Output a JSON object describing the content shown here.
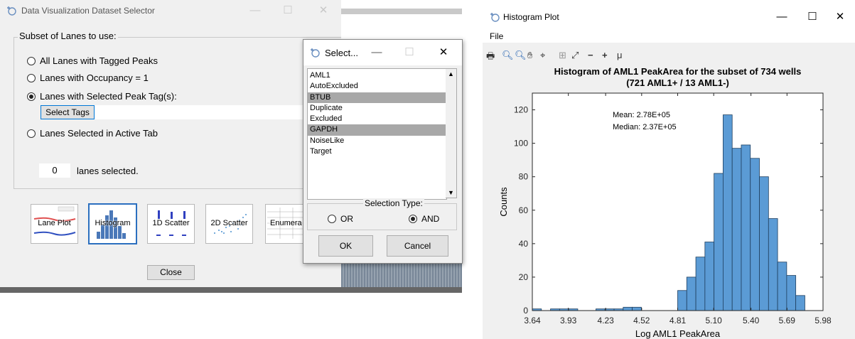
{
  "selector_window": {
    "title": "Data Visualization Dataset Selector",
    "group_title": "Subset of Lanes to use:",
    "options": [
      {
        "label": "All Lanes with Tagged Peaks",
        "selected": false
      },
      {
        "label": "Lanes with Occupancy = 1",
        "selected": false
      },
      {
        "label": "Lanes with Selected Peak Tag(s):",
        "selected": true
      },
      {
        "label": "Lanes Selected in Active Tab",
        "selected": false
      }
    ],
    "select_tags_button": "Select Tags",
    "lanes_count": "0",
    "lanes_selected_label": "lanes selected.",
    "thumbnails": [
      {
        "label": "Lane Plot",
        "selected": false
      },
      {
        "label": "Histogram",
        "selected": true
      },
      {
        "label": "1D Scatter",
        "selected": false
      },
      {
        "label": "2D Scatter",
        "selected": false
      },
      {
        "label": "Enumera",
        "selected": false
      }
    ],
    "close_button": "Close"
  },
  "select_dialog": {
    "title": "Select...",
    "items": [
      {
        "label": "AML1",
        "selected": false
      },
      {
        "label": "AutoExcluded",
        "selected": false
      },
      {
        "label": "BTUB",
        "selected": true
      },
      {
        "label": "Duplicate",
        "selected": false
      },
      {
        "label": "Excluded",
        "selected": false
      },
      {
        "label": "GAPDH",
        "selected": true
      },
      {
        "label": "NoiseLike",
        "selected": false
      },
      {
        "label": "Target",
        "selected": false
      }
    ],
    "selection_type_label": "Selection Type:",
    "or_label": "OR",
    "and_label": "AND",
    "selection_type": "AND",
    "ok_button": "OK",
    "cancel_button": "Cancel"
  },
  "histogram_window": {
    "title": "Histogram Plot",
    "menu_file": "File",
    "toolbar_icons": [
      "print-icon",
      "zoom-in-icon",
      "zoom-out-icon",
      "pan-icon",
      "data-cursor-icon",
      "grid-icon",
      "fit-icon",
      "minus-icon",
      "plus-icon",
      "mu-icon"
    ],
    "toolbar_text": {
      "minus": "−",
      "plus": "+",
      "mu": "μ"
    }
  },
  "chart_data": {
    "type": "bar",
    "title": "Histogram of AML1 PeakArea for the subset of 734 wells",
    "subtitle": "(721 AML1+ / 13 AML1-)",
    "xlabel": "Log AML1 PeakArea",
    "ylabel": "Counts",
    "xlim": [
      3.64,
      5.98
    ],
    "ylim": [
      0,
      130
    ],
    "xticks": [
      "3.64",
      "3.93",
      "4.23",
      "4.52",
      "4.81",
      "5.10",
      "5.40",
      "5.69",
      "5.98"
    ],
    "yticks": [
      "0",
      "20",
      "40",
      "60",
      "80",
      "100",
      "120"
    ],
    "bin_edges": [
      3.64,
      3.7131,
      3.7863,
      3.8594,
      3.9325,
      4.0056,
      4.0788,
      4.1519,
      4.225,
      4.2981,
      4.3713,
      4.4444,
      4.5175,
      4.5906,
      4.6638,
      4.7369,
      4.81,
      4.8831,
      4.9563,
      5.0294,
      5.1025,
      5.1756,
      5.2488,
      5.3219,
      5.395,
      5.4681,
      5.5413,
      5.6144,
      5.6875,
      5.7606,
      5.8338,
      5.9069,
      5.98
    ],
    "values": [
      1,
      0,
      1,
      1,
      1,
      0,
      0,
      1,
      1,
      1,
      2,
      2,
      12,
      20,
      32,
      41,
      82,
      117,
      97,
      99,
      91,
      80,
      55,
      29,
      21,
      9
    ],
    "bar_start_index": 0,
    "bar_bins": [
      0,
      1,
      2,
      3,
      4,
      5,
      6,
      7,
      8,
      9,
      10,
      11,
      16,
      17,
      18,
      19,
      20,
      21,
      22,
      23,
      24,
      25,
      26,
      27,
      28,
      29
    ],
    "annotations": [
      "Mean: 2.78E+05",
      "Median: 2.37E+05"
    ],
    "bar_color": "#5b9bd5"
  }
}
